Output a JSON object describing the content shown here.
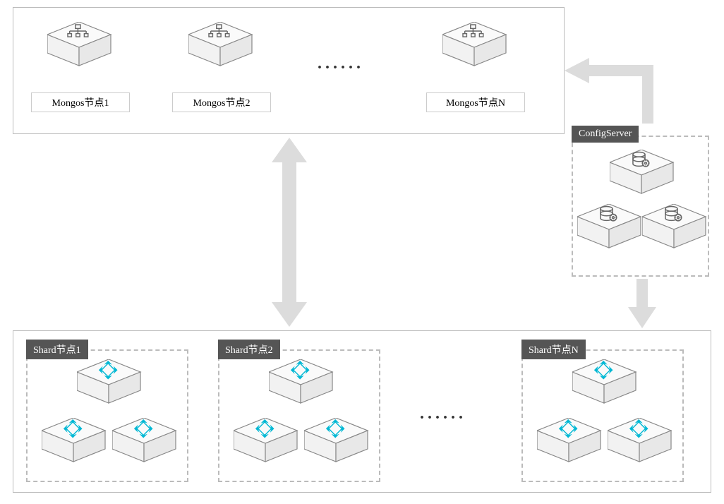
{
  "mongos": {
    "node1": "Mongos节点1",
    "node2": "Mongos节点2",
    "nodeN": "Mongos节点N"
  },
  "configServer": {
    "label": "ConfigServer"
  },
  "shards": {
    "node1": "Shard节点1",
    "node2": "Shard节点2",
    "nodeN": "Shard节点N"
  },
  "ellipsis": "······"
}
